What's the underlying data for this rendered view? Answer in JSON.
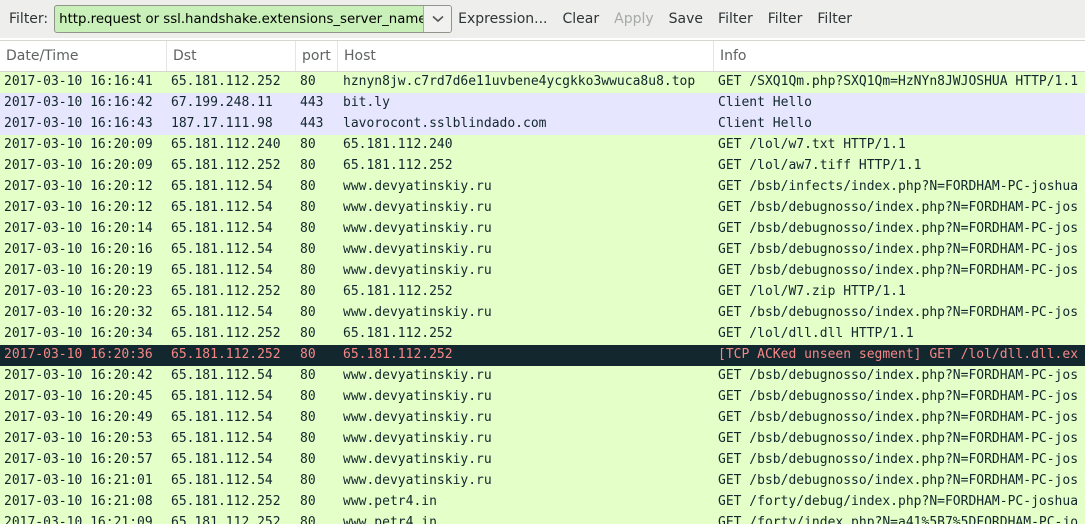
{
  "colors": {
    "http_row_bg": "#e4ffc7",
    "tls_row_bg": "#e7e6ff",
    "bad_row_bg": "#12272e",
    "bad_row_fg": "#f78787",
    "normal_fg": "#12272e",
    "filter_valid_bg": "#c9f0b9",
    "toolbar_bg": "#eeeeec"
  },
  "toolbar": {
    "filter_label": "Filter:",
    "filter_value": "http.request or ssl.handshake.extensions_server_name",
    "dropdown_icon": "chevron-down-icon",
    "buttons": [
      {
        "label": "Expression...",
        "enabled": true
      },
      {
        "label": "Clear",
        "enabled": true
      },
      {
        "label": "Apply",
        "enabled": false
      },
      {
        "label": "Save",
        "enabled": true
      },
      {
        "label": "Filter",
        "enabled": true
      },
      {
        "label": "Filter",
        "enabled": true
      },
      {
        "label": "Filter",
        "enabled": true
      }
    ]
  },
  "columns": [
    "Date/Time",
    "Dst",
    "port",
    "Host",
    "Info"
  ],
  "packets": [
    {
      "time": "2017-03-10 16:16:41",
      "dst": "65.181.112.252",
      "port": "80",
      "host": "hznyn8jw.c7rd7d6e11uvbene4ycgkko3wwuca8u8.top",
      "info": "GET /SXQ1Qm.php?SXQ1Qm=HzNYn8JWJOSHUA HTTP/1.1",
      "kind": "http"
    },
    {
      "time": "2017-03-10 16:16:42",
      "dst": "67.199.248.11",
      "port": "443",
      "host": "bit.ly",
      "info": "Client Hello",
      "kind": "tls"
    },
    {
      "time": "2017-03-10 16:16:43",
      "dst": "187.17.111.98",
      "port": "443",
      "host": "lavorocont.sslblindado.com",
      "info": "Client Hello",
      "kind": "tls"
    },
    {
      "time": "2017-03-10 16:20:09",
      "dst": "65.181.112.240",
      "port": "80",
      "host": "65.181.112.240",
      "info": "GET /lol/w7.txt HTTP/1.1",
      "kind": "http"
    },
    {
      "time": "2017-03-10 16:20:09",
      "dst": "65.181.112.252",
      "port": "80",
      "host": "65.181.112.252",
      "info": "GET /lol/aw7.tiff HTTP/1.1",
      "kind": "http"
    },
    {
      "time": "2017-03-10 16:20:12",
      "dst": "65.181.112.54",
      "port": "80",
      "host": "www.devyatinskiy.ru",
      "info": "GET /bsb/infects/index.php?N=FORDHAM-PC-joshua",
      "kind": "http"
    },
    {
      "time": "2017-03-10 16:20:12",
      "dst": "65.181.112.54",
      "port": "80",
      "host": "www.devyatinskiy.ru",
      "info": "GET /bsb/debugnosso/index.php?N=FORDHAM-PC-jos",
      "kind": "http"
    },
    {
      "time": "2017-03-10 16:20:14",
      "dst": "65.181.112.54",
      "port": "80",
      "host": "www.devyatinskiy.ru",
      "info": "GET /bsb/debugnosso/index.php?N=FORDHAM-PC-jos",
      "kind": "http"
    },
    {
      "time": "2017-03-10 16:20:16",
      "dst": "65.181.112.54",
      "port": "80",
      "host": "www.devyatinskiy.ru",
      "info": "GET /bsb/debugnosso/index.php?N=FORDHAM-PC-jos",
      "kind": "http"
    },
    {
      "time": "2017-03-10 16:20:19",
      "dst": "65.181.112.54",
      "port": "80",
      "host": "www.devyatinskiy.ru",
      "info": "GET /bsb/debugnosso/index.php?N=FORDHAM-PC-jos",
      "kind": "http"
    },
    {
      "time": "2017-03-10 16:20:23",
      "dst": "65.181.112.252",
      "port": "80",
      "host": "65.181.112.252",
      "info": "GET /lol/W7.zip HTTP/1.1",
      "kind": "http"
    },
    {
      "time": "2017-03-10 16:20:32",
      "dst": "65.181.112.54",
      "port": "80",
      "host": "www.devyatinskiy.ru",
      "info": "GET /bsb/debugnosso/index.php?N=FORDHAM-PC-jos",
      "kind": "http"
    },
    {
      "time": "2017-03-10 16:20:34",
      "dst": "65.181.112.252",
      "port": "80",
      "host": "65.181.112.252",
      "info": "GET /lol/dll.dll HTTP/1.1",
      "kind": "http"
    },
    {
      "time": "2017-03-10 16:20:36",
      "dst": "65.181.112.252",
      "port": "80",
      "host": "65.181.112.252",
      "info": "[TCP ACKed unseen segment] GET /lol/dll.dll.ex",
      "kind": "bad"
    },
    {
      "time": "2017-03-10 16:20:42",
      "dst": "65.181.112.54",
      "port": "80",
      "host": "www.devyatinskiy.ru",
      "info": "GET /bsb/debugnosso/index.php?N=FORDHAM-PC-jos",
      "kind": "http"
    },
    {
      "time": "2017-03-10 16:20:45",
      "dst": "65.181.112.54",
      "port": "80",
      "host": "www.devyatinskiy.ru",
      "info": "GET /bsb/debugnosso/index.php?N=FORDHAM-PC-jos",
      "kind": "http"
    },
    {
      "time": "2017-03-10 16:20:49",
      "dst": "65.181.112.54",
      "port": "80",
      "host": "www.devyatinskiy.ru",
      "info": "GET /bsb/debugnosso/index.php?N=FORDHAM-PC-jos",
      "kind": "http"
    },
    {
      "time": "2017-03-10 16:20:53",
      "dst": "65.181.112.54",
      "port": "80",
      "host": "www.devyatinskiy.ru",
      "info": "GET /bsb/debugnosso/index.php?N=FORDHAM-PC-jos",
      "kind": "http"
    },
    {
      "time": "2017-03-10 16:20:57",
      "dst": "65.181.112.54",
      "port": "80",
      "host": "www.devyatinskiy.ru",
      "info": "GET /bsb/debugnosso/index.php?N=FORDHAM-PC-jos",
      "kind": "http"
    },
    {
      "time": "2017-03-10 16:21:01",
      "dst": "65.181.112.54",
      "port": "80",
      "host": "www.devyatinskiy.ru",
      "info": "GET /bsb/debugnosso/index.php?N=FORDHAM-PC-jos",
      "kind": "http"
    },
    {
      "time": "2017-03-10 16:21:08",
      "dst": "65.181.112.252",
      "port": "80",
      "host": "www.petr4.in",
      "info": "GET /forty/debug/index.php?N=FORDHAM-PC-joshua",
      "kind": "http"
    },
    {
      "time": "2017-03-10 16:21:09",
      "dst": "65.181.112.252",
      "port": "80",
      "host": "www.petr4.in",
      "info": "GET /forty/index.php?N=a41%5B7%5DFORDHAM-PC-jo",
      "kind": "http"
    }
  ]
}
